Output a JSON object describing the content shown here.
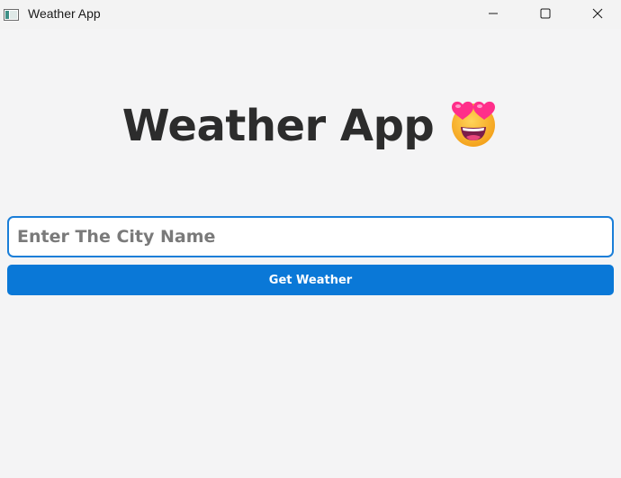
{
  "window": {
    "title": "Weather App",
    "controls": {
      "minimize_icon": "minimize-icon",
      "maximize_icon": "maximize-icon",
      "close_icon": "close-icon"
    }
  },
  "main": {
    "heading": "Weather App",
    "heading_emoji": "smiling-face-with-heart-eyes-icon",
    "search": {
      "value": "",
      "placeholder": "Enter The City Name"
    },
    "submit_label": "Get Weather"
  },
  "colors": {
    "accent": "#0a78d7",
    "input_border": "#1a7ed8",
    "background": "#f4f4f5",
    "heading_text": "#2c2c2c"
  }
}
